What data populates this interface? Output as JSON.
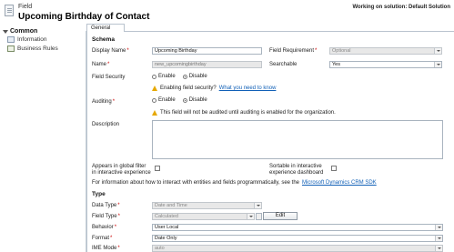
{
  "header": {
    "entity_label": "Field",
    "title": "Upcoming Birthday of Contact",
    "solution": "Working on solution: Default Solution"
  },
  "nav": {
    "section": "Common",
    "items": [
      {
        "label": "Information",
        "icon": "information-icon"
      },
      {
        "label": "Business Rules",
        "icon": "business-rules-icon"
      }
    ]
  },
  "tab": {
    "label": "General"
  },
  "schema": {
    "heading": "Schema",
    "display_name": {
      "label": "Display Name",
      "value": "Upcoming Birthday"
    },
    "field_requirement": {
      "label": "Field Requirement",
      "value": "Optional"
    },
    "name": {
      "label": "Name",
      "value": "new_upcomingbirthday"
    },
    "searchable": {
      "label": "Searchable",
      "value": "Yes"
    },
    "field_security": {
      "label": "Field Security",
      "enable": "Enable",
      "disable": "Disable",
      "selected": "Disable"
    },
    "field_security_warning": {
      "text": "Enabling field security?",
      "link": "What you need to know"
    },
    "auditing": {
      "label": "Auditing",
      "enable": "Enable",
      "disable": "Disable",
      "selected": "Disable"
    },
    "auditing_warning": {
      "text": "This field will not be audited until auditing is enabled for the organization."
    },
    "description": {
      "label": "Description",
      "value": ""
    },
    "global_filter": {
      "label_line1": "Appears in global filter",
      "label_line2": "in interactive experience",
      "checked": false
    },
    "sortable": {
      "label_line1": "Sortable in interactive",
      "label_line2": "experience dashboard",
      "checked": false
    },
    "info": {
      "text": "For information about how to interact with entities and fields programmatically, see the",
      "link": "Microsoft Dynamics CRM SDK"
    }
  },
  "type": {
    "heading": "Type",
    "data_type": {
      "label": "Data Type",
      "value": "Date and Time"
    },
    "field_type": {
      "label": "Field Type",
      "value": "Calculated",
      "edit_button": "Edit"
    },
    "behavior": {
      "label": "Behavior",
      "value": "User Local"
    },
    "format": {
      "label": "Format",
      "value": "Date Only"
    },
    "ime_mode": {
      "label": "IME Mode",
      "value": "auto"
    }
  },
  "required_marker": "*"
}
